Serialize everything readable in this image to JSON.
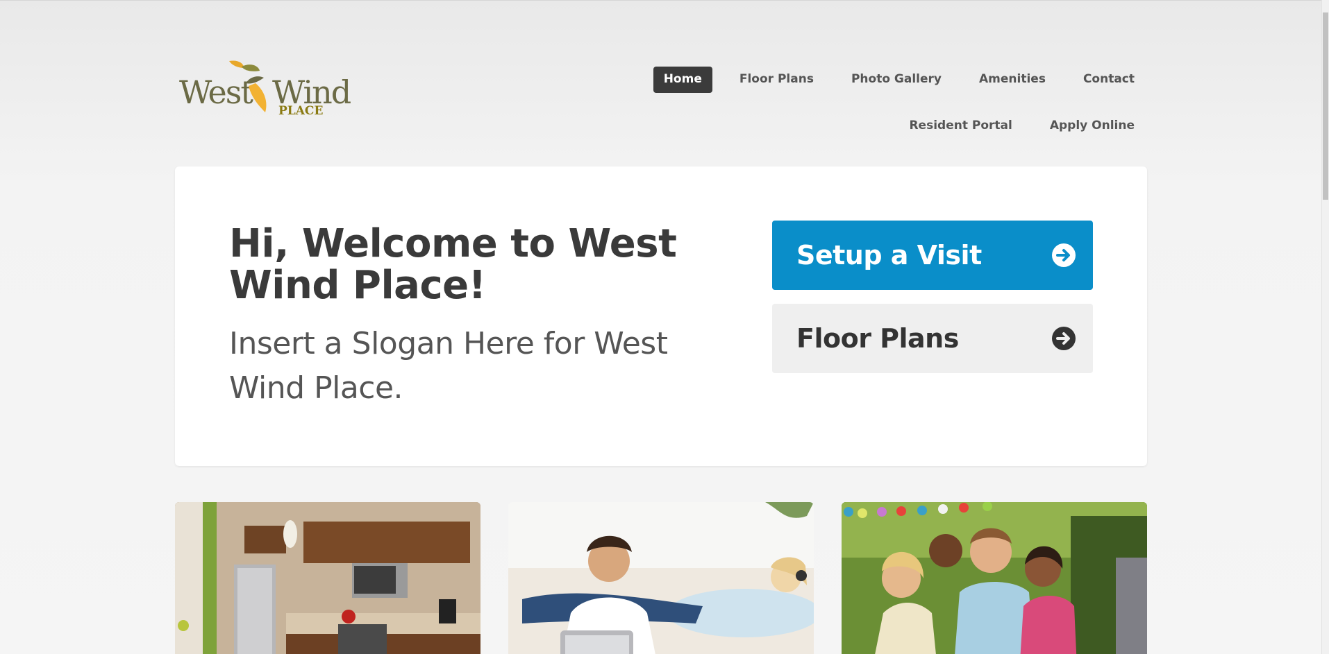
{
  "brand": {
    "logo_west": "West",
    "logo_wind": "Wind",
    "logo_place": "PLACE",
    "colors": {
      "olive": "#6b6a45",
      "gold": "#e8a82a",
      "leaf_green": "#8c8a3c"
    }
  },
  "nav": {
    "row1": [
      "Home",
      "Floor Plans",
      "Photo Gallery",
      "Amenities",
      "Contact"
    ],
    "row2": [
      "Resident Portal",
      "Apply Online"
    ],
    "active": "Home"
  },
  "hero": {
    "title": "Hi, Welcome to West Wind Place!",
    "slogan": "Insert a Slogan Here for West Wind Place.",
    "cta_visit": "Setup a Visit",
    "cta_plans": "Floor Plans",
    "cta_visit_color": "#0a8ec9",
    "cta_icon": "arrow-circle-right-icon"
  },
  "photos": [
    {
      "name": "kitchen-photo"
    },
    {
      "name": "couple-relaxing-photo"
    },
    {
      "name": "friends-party-photo"
    }
  ]
}
